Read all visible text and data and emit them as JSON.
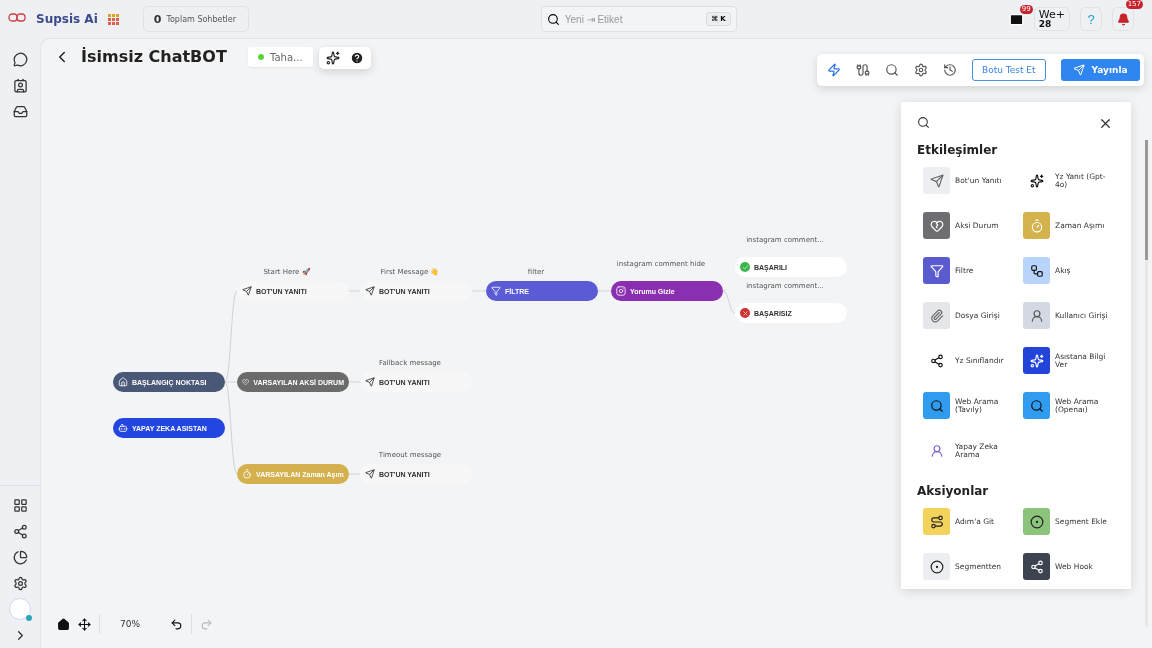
{
  "topbar": {
    "brand": "Supsis Ai",
    "total_count": "0",
    "total_label": "Toplam Sohbetler",
    "search": {
      "placeholder": "Yeni ⇥ Etiket",
      "shortcut": "⌘ K"
    },
    "mail_badge": "99",
    "user": {
      "initials": "We",
      "plus": "+",
      "number": "28"
    },
    "help": "?",
    "bell_badge": "157"
  },
  "sidebar": {
    "top_items": [
      {
        "kind": "chat"
      },
      {
        "kind": "contact"
      },
      {
        "kind": "inbox"
      }
    ],
    "bottom_items": [
      {
        "kind": "apps"
      },
      {
        "kind": "share"
      },
      {
        "kind": "chart"
      },
      {
        "kind": "settings"
      },
      {
        "kind": "avatar"
      },
      {
        "kind": "expand"
      }
    ]
  },
  "canvas": {
    "title": "İsimsiz ChatBOT",
    "status_chip": {
      "label": "Taha...",
      "online": true
    },
    "toolbar": {
      "icons": [
        {
          "kind": "bolt",
          "selected": true
        },
        {
          "kind": "plug",
          "selected": false
        },
        {
          "kind": "search",
          "selected": false
        },
        {
          "kind": "settings",
          "selected": false
        },
        {
          "kind": "history",
          "selected": false
        }
      ],
      "test_button": "Botu Test Et",
      "publish_button": "Yayınla"
    },
    "nodes": [
      {
        "kind": "start",
        "label": "BAŞLANGIÇ NOKTASI"
      },
      {
        "kind": "ai",
        "label": "YAPAY ZEKA ASISTAN"
      },
      {
        "kind": "reply",
        "title": "Start Here 🚀",
        "label": "BOT'UN YANITI"
      },
      {
        "kind": "reply",
        "title": "First Message 👋",
        "label": "BOT'UN YANITI"
      },
      {
        "kind": "filter",
        "title": "filter",
        "label": "FİLTRE"
      },
      {
        "kind": "instagram",
        "title": "instagram comment hide",
        "label": "Yorumu Gizle"
      },
      {
        "kind": "success",
        "title": "instagram comment...",
        "label": "BAŞARILI"
      },
      {
        "kind": "failure",
        "title": "instagram comment...",
        "label": "BAŞARISIZ"
      },
      {
        "kind": "fallback",
        "label": "VARSAYILAN AKSİ DURUM"
      },
      {
        "kind": "reply",
        "title": "Fallback message",
        "label": "BOT'UN YANITI"
      },
      {
        "kind": "timeout",
        "label": "VARSAYILAN Zaman Aşım"
      },
      {
        "kind": "reply",
        "title": "Timeout message",
        "label": "BOT'UN YANITI"
      }
    ],
    "controls": {
      "zoom": "70%",
      "undo_disabled": false,
      "redo_disabled": true
    }
  },
  "panel": {
    "sections": [
      {
        "title": "Etkileşimler",
        "items": [
          {
            "label": "Bot'un Yanıtı",
            "kind": "reply",
            "color": "#eceef1"
          },
          {
            "label": "Yz Yanıt (Gpt-4o)",
            "kind": "ai-reply",
            "color": "#ffffff"
          },
          {
            "label": "Aksi Durum",
            "kind": "fallback",
            "color": "#6e6e72"
          },
          {
            "label": "Zaman Aşımı",
            "kind": "timeout",
            "color": "#d4b24c"
          },
          {
            "label": "Filtre",
            "kind": "filter",
            "color": "#5b5bd0"
          },
          {
            "label": "Akış",
            "kind": "flow",
            "color": "#b8d4fb"
          },
          {
            "label": "Dosya Girişi",
            "kind": "file",
            "color": "#e4e6ea"
          },
          {
            "label": "Kullanıcı Girişi",
            "kind": "user-input",
            "color": "#d3d8e3"
          },
          {
            "label": "Yz Sınıflandır",
            "kind": "classify",
            "color": "#ffffff"
          },
          {
            "label": "Asıstana Bilgi Ver",
            "kind": "assistant",
            "color": "#2244d8"
          },
          {
            "label": "Web Arama (Tavıly)",
            "kind": "web-search",
            "color": "#2f9cf0"
          },
          {
            "label": "Web Arama (Openaı)",
            "kind": "web-search",
            "color": "#2f9cf0"
          },
          {
            "label": "Yapay Zeka Arama",
            "kind": "ai-call",
            "color": "#ffffff"
          }
        ]
      },
      {
        "title": "Aksiyonlar",
        "items": [
          {
            "label": "Adım'a Git",
            "kind": "goto",
            "color": "#f3d35c"
          },
          {
            "label": "Segment Ekle",
            "kind": "segment",
            "color": "#8cc47c"
          },
          {
            "label": "Segmentten",
            "kind": "segment",
            "color": "#eceef1"
          },
          {
            "label": "Web Hook",
            "kind": "webhook",
            "color": "#3d4450"
          }
        ]
      }
    ]
  }
}
